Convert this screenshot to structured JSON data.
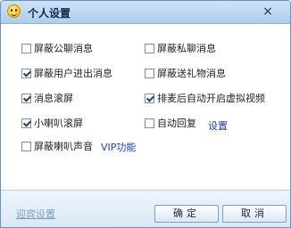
{
  "window": {
    "title": "个人设置",
    "close_symbol": "×"
  },
  "options": [
    {
      "id": "block-public-chat",
      "label": "屏蔽公聊消息",
      "checked": false
    },
    {
      "id": "block-private-chat",
      "label": "屏蔽私聊消息",
      "checked": false
    },
    {
      "id": "block-user-join-leave",
      "label": "屏蔽用户进出消息",
      "checked": true
    },
    {
      "id": "block-gift-messages",
      "label": "屏蔽送礼物消息",
      "checked": false
    },
    {
      "id": "message-scroll",
      "label": "消息滚屏",
      "checked": true
    },
    {
      "id": "auto-virtual-video",
      "label": "排麦后自动开启虚拟视频",
      "checked": true
    },
    {
      "id": "horn-scroll",
      "label": "小喇叭滚屏",
      "checked": true
    },
    {
      "id": "auto-reply",
      "label": "自动回复",
      "checked": false
    },
    {
      "id": "block-horn-sound",
      "label": "屏蔽喇叭声音",
      "checked": false
    }
  ],
  "links": {
    "settings": "设置",
    "vip_feature": "VIP功能"
  },
  "footer": {
    "guest_settings": "迎宾设置",
    "ok": "确定",
    "cancel": "取消"
  }
}
